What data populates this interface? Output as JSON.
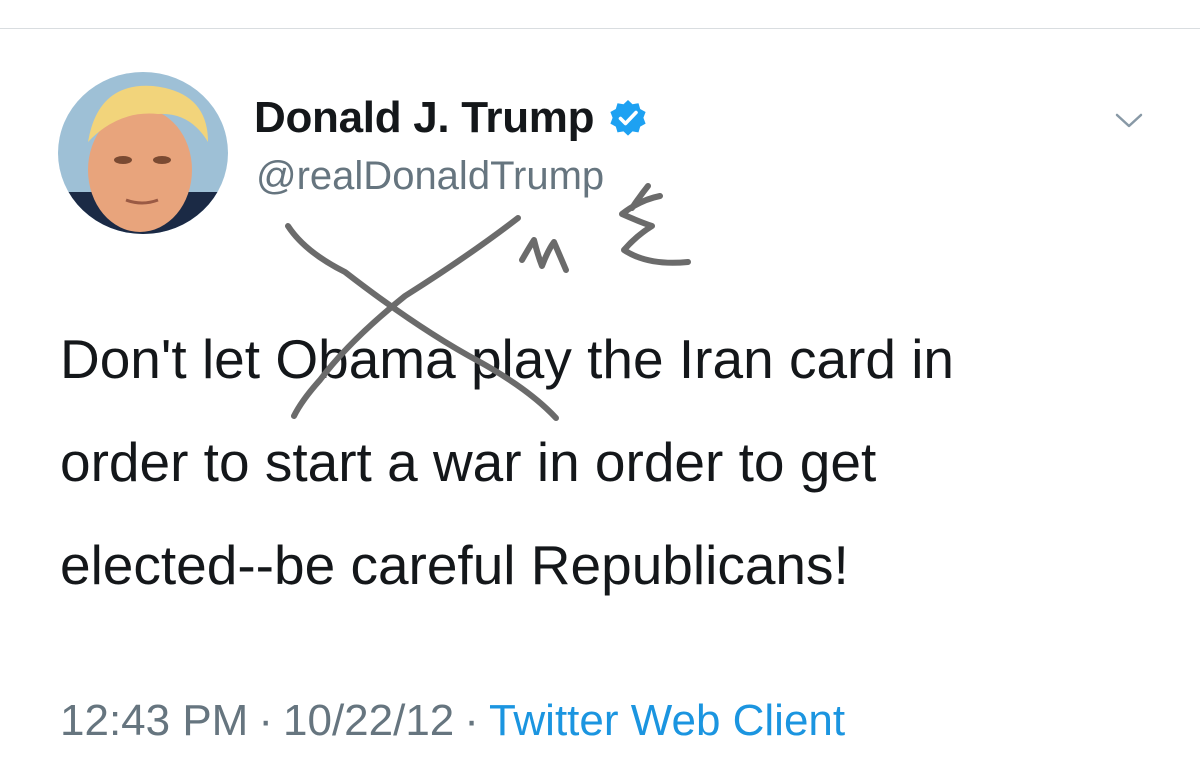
{
  "tweet": {
    "author": {
      "display_name": "Donald J. Trump",
      "handle": "@realDonaldTrump",
      "verified": true,
      "avatar_icon": "profile-photo"
    },
    "text_lines": [
      "Don't let Obama play the Iran card in",
      "order to start a war in order to get",
      "elected--be careful Republicans!"
    ],
    "meta": {
      "time": "12:43 PM",
      "separator": "·",
      "date": "10/22/12",
      "client": "Twitter Web Client"
    },
    "menu_icon": "chevron-down-icon"
  },
  "annotation": {
    "handwritten_text": "ME",
    "mark": "x-strikeout"
  },
  "colors": {
    "text": "#14171a",
    "secondary": "#66757f",
    "link": "#1b95e0",
    "verified": "#1da1f2",
    "scribble": "#6b6b6b"
  }
}
